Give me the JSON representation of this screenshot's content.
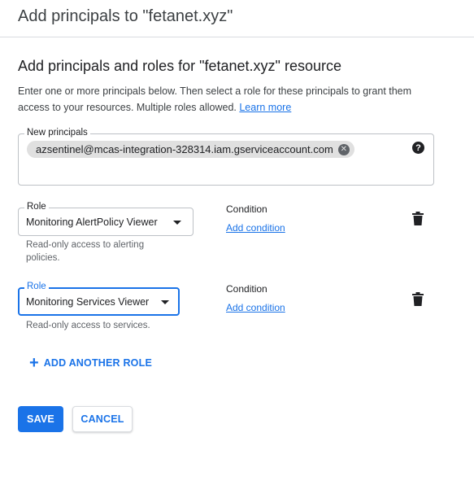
{
  "dialog": {
    "title": "Add principals to \"fetanet.xyz\""
  },
  "section": {
    "title": "Add principals and roles for \"fetanet.xyz\" resource",
    "description": "Enter one or more principals below. Then select a role for these principals to grant them access to your resources. Multiple roles allowed.",
    "learn_more": "Learn more"
  },
  "principals": {
    "label": "New principals",
    "chips": [
      "azsentinel@mcas-integration-328314.iam.gserviceaccount.com"
    ],
    "help_icon": "help-icon"
  },
  "roles": [
    {
      "label": "Role",
      "value": "Monitoring AlertPolicy Viewer",
      "description": "Read-only access to alerting policies.",
      "condition_label": "Condition",
      "add_condition": "Add condition",
      "focused": false
    },
    {
      "label": "Role",
      "value": "Monitoring Services Viewer",
      "description": "Read-only access to services.",
      "condition_label": "Condition",
      "add_condition": "Add condition",
      "focused": true
    }
  ],
  "add_another_role": "ADD ANOTHER ROLE",
  "actions": {
    "save": "SAVE",
    "cancel": "CANCEL"
  },
  "colors": {
    "accent": "#1a73e8",
    "text": "#202124",
    "secondary_text": "#5f6368",
    "border": "#bdc1c6",
    "chip_bg": "#e0e0e0"
  }
}
